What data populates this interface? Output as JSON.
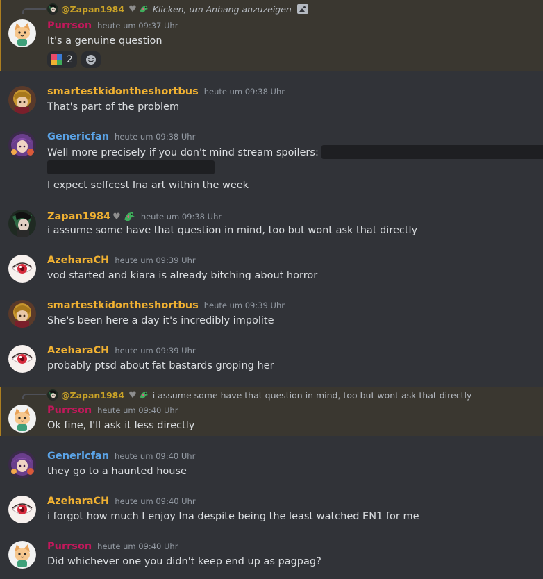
{
  "colors": {
    "background": "#313338",
    "highlight": "#3a3730",
    "purrson": "#c2185b",
    "gold": "#f0b132",
    "blue": "#5ba4e8",
    "timestamp": "#949ba4"
  },
  "messages": [
    {
      "reply": {
        "name": "@Zapan1984",
        "text": "Klicken, um Anhang anzuzeigen",
        "icon": "image-icon"
      },
      "author": "Purrson",
      "time": "heute um 09:37 Uhr",
      "text": "It's a genuine question",
      "reaction": {
        "emoji": "puzzle-emoji",
        "count": "2"
      }
    },
    {
      "author": "smartestkidontheshortbus",
      "time": "heute um 09:38 Uhr",
      "text": "That's part of the problem"
    },
    {
      "author": "Genericfan",
      "time": "heute um 09:38 Uhr",
      "text": "Well more precisely if you don't mind stream spoilers:",
      "text2": "I expect selfcest Ina art within the week"
    },
    {
      "author": "Zapan1984",
      "time": "heute um 09:38 Uhr",
      "text": "i assume some have that question in mind, too but wont ask  that directly"
    },
    {
      "author": "AzeharaCH",
      "time": "heute um 09:39 Uhr",
      "text": "vod started and kiara is already bitching about horror"
    },
    {
      "author": "smartestkidontheshortbus",
      "time": "heute um 09:39 Uhr",
      "text": "She's been here a day it's incredibly impolite"
    },
    {
      "author": "AzeharaCH",
      "time": "heute um 09:39 Uhr",
      "text": "probably ptsd about fat bastards groping her"
    },
    {
      "reply": {
        "name": "@Zapan1984",
        "text": "i assume some have that question in mind, too but wont ask  that directly"
      },
      "author": "Purrson",
      "time": "heute um 09:40 Uhr",
      "text": "Ok fine, I'll ask it less directly"
    },
    {
      "author": "Genericfan",
      "time": "heute um 09:40 Uhr",
      "text": "they go to a haunted house"
    },
    {
      "author": "AzeharaCH",
      "time": "heute um 09:40 Uhr",
      "text": "i forgot how much I enjoy Ina despite being the least watched EN1 for me"
    },
    {
      "author": "Purrson",
      "time": "heute um 09:40 Uhr",
      "text": "Did whichever one you didn't keep end up as pagpag?"
    }
  ]
}
